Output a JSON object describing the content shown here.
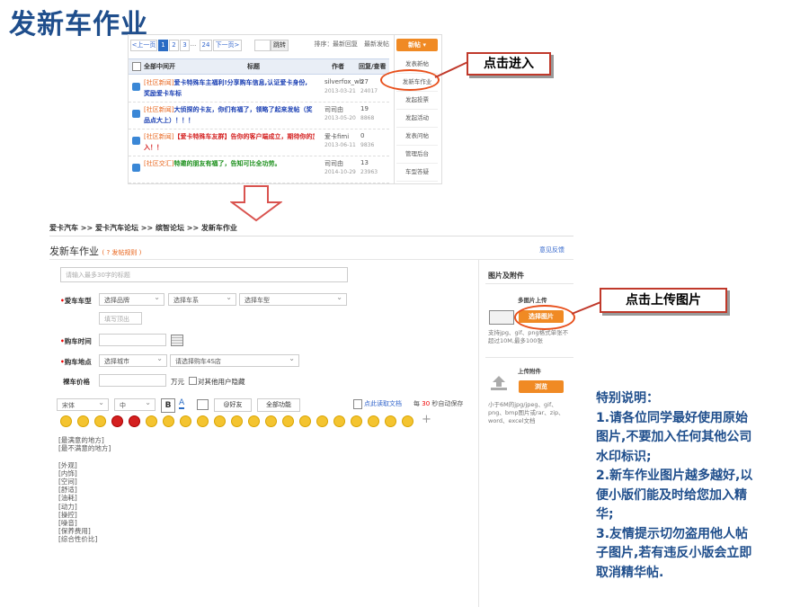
{
  "page_title": "发新车作业",
  "forum": {
    "pager": {
      "prev": "<上一页",
      "pages": [
        "1",
        "2",
        "3"
      ],
      "ellipsis": "...",
      "last": "24",
      "next": "下一页>",
      "go": "跳转"
    },
    "toplinks": {
      "sort": "排序：",
      "latest_reply": "最新回复",
      "latest_post": "最新发帖"
    },
    "new_post_btn": "新帖",
    "header": {
      "all": "全部中间开",
      "title": "标题",
      "author": "作者",
      "reply_view": "回复/查看"
    },
    "rows": [
      {
        "tag": "[社区新闻]",
        "title": "爱卡特殊车主福利!分享购车信息,认证爱卡身份,",
        "title2": "奖励爱卡车标",
        "meta": "[只看图]",
        "author": "silverfox_wb",
        "date": "2013-03-21",
        "replies": "27",
        "views": "24017",
        "color": "#1a3fb3"
      },
      {
        "tag": "[社区新闻]",
        "title": "大侦探的卡友，你们有福了，领略了起来发帖（奖",
        "title2": "品点大上）！！！",
        "meta": "[只看图]",
        "author": "司司由",
        "date": "2013-05-20",
        "replies": "19",
        "views": "8868",
        "color": "#1a3fb3"
      },
      {
        "tag": "[社区新闻]",
        "title": "【爱卡特殊车友群】告你的客户端成立，期待你的加",
        "title2": "入！！",
        "meta": "[只看图]",
        "author": "爱卡fimi",
        "date": "2013-06-11",
        "replies": "0",
        "views": "9836",
        "color": "#d42020"
      },
      {
        "tag": "[社区交汇]",
        "title": "特邀的朋友有福了，告知可比全功劳。",
        "title2": "",
        "meta": "[只看图]",
        "author": "司司由",
        "date": "2014-10-29",
        "replies": "13",
        "views": "23963",
        "color": "#1a8f1a"
      }
    ],
    "dropdown_items": [
      "发表新帖",
      "发新车作业",
      "发起投票",
      "发起活动",
      "发表问帖",
      "管理后台",
      "车型答疑"
    ]
  },
  "callout_enter": "点击进入",
  "callout_upload": "点击上传图片",
  "breadcrumb": "爱卡汽车 >> 爱卡汽车论坛 >> 缤智论坛 >> 发新车作业",
  "section": {
    "title": "发新车作业",
    "note": "( ? 发帖规则 )",
    "report": "意见反馈"
  },
  "form": {
    "title_placeholder": "请输入最多30字的标题",
    "car_label": "爱车车型",
    "brand": "选择品牌",
    "series": "选择车系",
    "model": "选择车型",
    "custom_placeholder": "填写顶出",
    "date_label": "购车时间",
    "place_label": "购车地点",
    "city": "选择城市",
    "dealer": "请选择购车4S店",
    "price_label": "裸车价格",
    "price_unit": "万元",
    "price_checkbox": "对其他用户隐藏",
    "toolbar": {
      "font": "宋体",
      "size": "中",
      "bold": "B",
      "friend": "@好友",
      "all_func": "全部功能",
      "draft": "点此读取文档",
      "counter_pre": "每",
      "counter": "30",
      "counter_post": "秒自动保存"
    },
    "editor_lines": [
      "[最满意的地方]",
      "[最不满意的地方]",
      "",
      "[外观]",
      "[内饰]",
      "[空间]",
      "[舒适]",
      "[油耗]",
      "[动力]",
      "[操控]",
      "[噪音]",
      "[保养费用]",
      "[综合性价比]"
    ]
  },
  "side": {
    "title": "图片及附件",
    "pic_label": "多图片上传",
    "pic_btn": "选择图片",
    "pic_hint": "支持jpg、gif、png格式单张不超过10M,最多100张",
    "file_label": "上传附件",
    "file_btn": "浏览",
    "file_hint": "小于6M的jpg/jpeg、gif、png、bmp图片或rar、zip、word、excel文档"
  },
  "special_note": {
    "heading": "特别说明：",
    "lines": [
      "1.请各位同学最好使用原始",
      "图片,不要加入任何其他公司",
      "水印标识;",
      "2.新车作业图片越多越好,以",
      "便小版们能及时给您加入精",
      "华;",
      "3.友情提示切勿盗用他人帖",
      "子图片,若有违反小版会立即",
      "取消精华帖."
    ]
  }
}
